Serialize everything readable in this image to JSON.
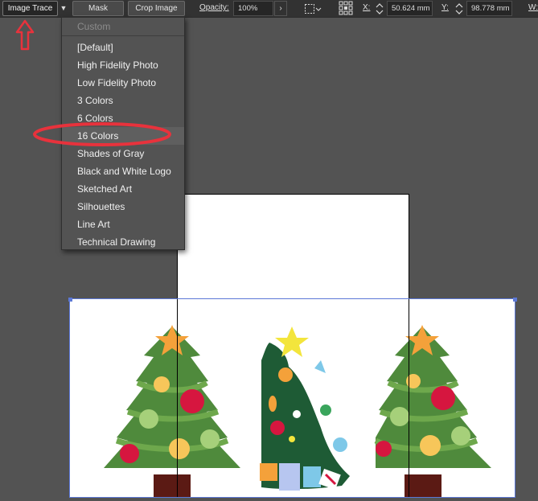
{
  "control_bar": {
    "image_trace_label": "Image Trace",
    "mask_label": "Mask",
    "crop_image_label": "Crop Image",
    "opacity_label": "Opacity:",
    "opacity_value": "100%",
    "x_label": "X:",
    "x_value": "50.624 mm",
    "y_label": "Y:",
    "y_value": "98.778 mm",
    "w_label": "W:"
  },
  "preset_menu": {
    "items": [
      {
        "label": "Custom",
        "enabled": false
      },
      {
        "label": "[Default]",
        "enabled": true
      },
      {
        "label": "High Fidelity Photo",
        "enabled": true
      },
      {
        "label": "Low Fidelity Photo",
        "enabled": true
      },
      {
        "label": "3 Colors",
        "enabled": true
      },
      {
        "label": "6 Colors",
        "enabled": true
      },
      {
        "label": "16 Colors",
        "enabled": true,
        "highlighted": true
      },
      {
        "label": "Shades of Gray",
        "enabled": true
      },
      {
        "label": "Black and White Logo",
        "enabled": true
      },
      {
        "label": "Sketched Art",
        "enabled": true
      },
      {
        "label": "Silhouettes",
        "enabled": true
      },
      {
        "label": "Line Art",
        "enabled": true
      },
      {
        "label": "Technical Drawing",
        "enabled": true
      }
    ]
  },
  "annotations": {
    "arrow_color": "#e8323c",
    "circle_color": "#e8323c"
  },
  "icons": {
    "dropdown": "chevron-down-icon",
    "opacity_arrow": "chevron-right-icon",
    "transform": "transform-icon",
    "reference_point": "reference-point-icon",
    "stepper": "stepper-icon"
  },
  "colors": {
    "app_bg": "#535353",
    "control_bar": "#323232",
    "selection": "#5c78d6"
  }
}
